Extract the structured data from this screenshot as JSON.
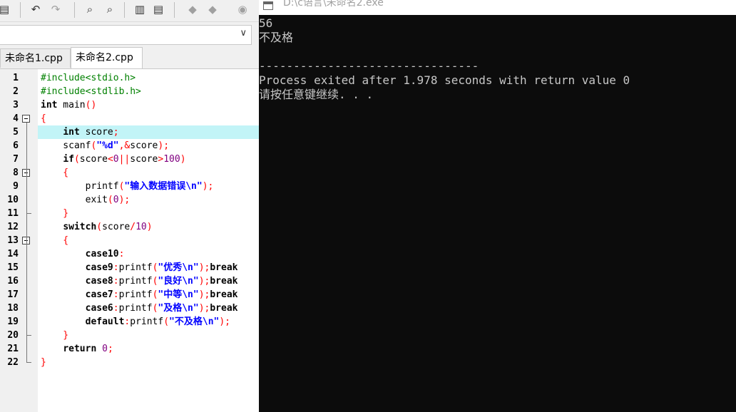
{
  "ide": {
    "tabs": [
      {
        "label": "未命名1.cpp",
        "active": false
      },
      {
        "label": "未命名2.cpp",
        "active": true
      }
    ],
    "current_line": 5,
    "line_numbers": [
      "1",
      "2",
      "3",
      "4",
      "5",
      "6",
      "7",
      "8",
      "9",
      "10",
      "11",
      "12",
      "13",
      "14",
      "15",
      "16",
      "17",
      "18",
      "19",
      "20",
      "21",
      "22"
    ],
    "code_lines": [
      [
        {
          "t": "#include<stdio.h>",
          "c": "pp"
        }
      ],
      [
        {
          "t": "#include<stdlib.h>",
          "c": "pp"
        }
      ],
      [
        {
          "t": "int",
          "c": "kw"
        },
        {
          "t": " main",
          "c": "id"
        },
        {
          "t": "()",
          "c": "sym"
        }
      ],
      [
        {
          "t": "{",
          "c": "sym"
        }
      ],
      [
        {
          "t": "    "
        },
        {
          "t": "int",
          "c": "kw"
        },
        {
          "t": " score",
          "c": "id"
        },
        {
          "t": ";",
          "c": "sym"
        }
      ],
      [
        {
          "t": "    scanf",
          "c": "id"
        },
        {
          "t": "(",
          "c": "sym"
        },
        {
          "t": "\"%d\"",
          "c": "str"
        },
        {
          "t": ",&",
          "c": "sym"
        },
        {
          "t": "score",
          "c": "id"
        },
        {
          "t": ");",
          "c": "sym"
        }
      ],
      [
        {
          "t": "    "
        },
        {
          "t": "if",
          "c": "kw"
        },
        {
          "t": "(",
          "c": "sym"
        },
        {
          "t": "score",
          "c": "id"
        },
        {
          "t": "<",
          "c": "sym"
        },
        {
          "t": "0",
          "c": "num"
        },
        {
          "t": "||",
          "c": "sym"
        },
        {
          "t": "score",
          "c": "id"
        },
        {
          "t": ">",
          "c": "sym"
        },
        {
          "t": "100",
          "c": "num"
        },
        {
          "t": ")",
          "c": "sym"
        }
      ],
      [
        {
          "t": "    {",
          "c": "sym"
        }
      ],
      [
        {
          "t": "        printf",
          "c": "id"
        },
        {
          "t": "(",
          "c": "sym"
        },
        {
          "t": "\"输入数据错误\\n\"",
          "c": "str"
        },
        {
          "t": ");",
          "c": "sym"
        }
      ],
      [
        {
          "t": "        exit",
          "c": "id"
        },
        {
          "t": "(",
          "c": "sym"
        },
        {
          "t": "0",
          "c": "num"
        },
        {
          "t": ");",
          "c": "sym"
        }
      ],
      [
        {
          "t": "    }",
          "c": "sym"
        }
      ],
      [
        {
          "t": "    "
        },
        {
          "t": "switch",
          "c": "kw"
        },
        {
          "t": "(",
          "c": "sym"
        },
        {
          "t": "score",
          "c": "id"
        },
        {
          "t": "/",
          "c": "sym"
        },
        {
          "t": "10",
          "c": "num"
        },
        {
          "t": ")",
          "c": "sym"
        }
      ],
      [
        {
          "t": "    {",
          "c": "sym"
        }
      ],
      [
        {
          "t": "        "
        },
        {
          "t": "case10",
          "c": "kw"
        },
        {
          "t": ":",
          "c": "sym"
        }
      ],
      [
        {
          "t": "        "
        },
        {
          "t": "case9",
          "c": "kw"
        },
        {
          "t": ":",
          "c": "sym"
        },
        {
          "t": "printf",
          "c": "id"
        },
        {
          "t": "(",
          "c": "sym"
        },
        {
          "t": "\"优秀\\n\"",
          "c": "str"
        },
        {
          "t": ");",
          "c": "sym"
        },
        {
          "t": "break",
          "c": "kw"
        }
      ],
      [
        {
          "t": "        "
        },
        {
          "t": "case8",
          "c": "kw"
        },
        {
          "t": ":",
          "c": "sym"
        },
        {
          "t": "printf",
          "c": "id"
        },
        {
          "t": "(",
          "c": "sym"
        },
        {
          "t": "\"良好\\n\"",
          "c": "str"
        },
        {
          "t": ");",
          "c": "sym"
        },
        {
          "t": "break",
          "c": "kw"
        }
      ],
      [
        {
          "t": "        "
        },
        {
          "t": "case7",
          "c": "kw"
        },
        {
          "t": ":",
          "c": "sym"
        },
        {
          "t": "printf",
          "c": "id"
        },
        {
          "t": "(",
          "c": "sym"
        },
        {
          "t": "\"中等\\n\"",
          "c": "str"
        },
        {
          "t": ");",
          "c": "sym"
        },
        {
          "t": "break",
          "c": "kw"
        }
      ],
      [
        {
          "t": "        "
        },
        {
          "t": "case6",
          "c": "kw"
        },
        {
          "t": ":",
          "c": "sym"
        },
        {
          "t": "printf",
          "c": "id"
        },
        {
          "t": "(",
          "c": "sym"
        },
        {
          "t": "\"及格\\n\"",
          "c": "str"
        },
        {
          "t": ");",
          "c": "sym"
        },
        {
          "t": "break",
          "c": "kw"
        }
      ],
      [
        {
          "t": "        "
        },
        {
          "t": "default",
          "c": "kw"
        },
        {
          "t": ":",
          "c": "sym"
        },
        {
          "t": "printf",
          "c": "id"
        },
        {
          "t": "(",
          "c": "sym"
        },
        {
          "t": "\"不及格\\n\"",
          "c": "str"
        },
        {
          "t": ");",
          "c": "sym"
        }
      ],
      [
        {
          "t": "    }",
          "c": "sym"
        }
      ],
      [
        {
          "t": "    "
        },
        {
          "t": "return",
          "c": "kw"
        },
        {
          "t": " "
        },
        {
          "t": "0",
          "c": "num"
        },
        {
          "t": ";",
          "c": "sym"
        }
      ],
      [
        {
          "t": "}",
          "c": "sym"
        }
      ]
    ],
    "toolbar_icons": [
      "print-icon",
      "undo-icon",
      "redo-icon",
      "find-icon",
      "replace-icon",
      "toggle-panel-icon",
      "split-view-icon",
      "bookmark-icon",
      "bookmark-next-icon",
      "bookmark-prev-icon"
    ]
  },
  "console": {
    "title": "D:\\c语言\\未命名2.exe",
    "lines": [
      "56",
      "不及格",
      "",
      "--------------------------------",
      "Process exited after 1.978 seconds with return value 0",
      "请按任意键继续. . ."
    ]
  },
  "colors": {
    "preprocessor": "#008000",
    "string": "#0000ff",
    "symbol": "#ff0000",
    "number": "#800080",
    "current_line": "#c2f4f7",
    "console_bg": "#0c0c0c",
    "console_fg": "#c7c7c7"
  }
}
